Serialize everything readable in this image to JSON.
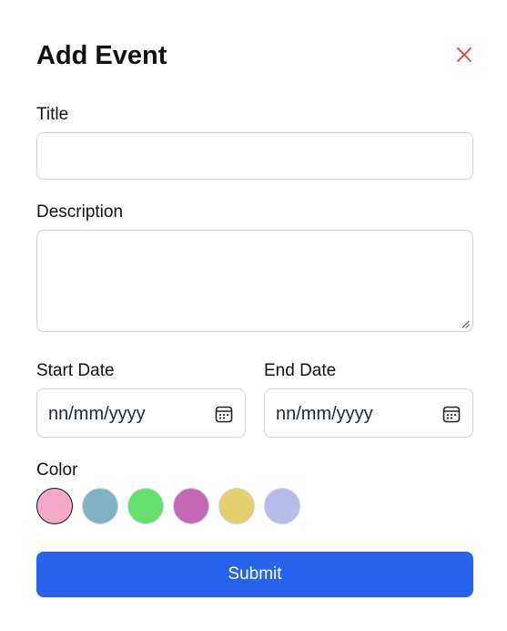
{
  "modal": {
    "title": "Add Event",
    "close_icon": "close-icon"
  },
  "form": {
    "title_label": "Title",
    "title_value": "",
    "description_label": "Description",
    "description_value": "",
    "start_date_label": "Start Date",
    "start_date_placeholder": "nn/mm/yyyy",
    "end_date_label": "End Date",
    "end_date_placeholder": "nn/mm/yyyy",
    "color_label": "Color",
    "colors": [
      "#f5a9c8",
      "#7fb3c4",
      "#66e06b",
      "#c566b7",
      "#e5cf6c",
      "#b8bbe8"
    ],
    "selected_color_index": 0,
    "submit_label": "Submit"
  },
  "theme": {
    "accent": "#2563eb",
    "close_color": "#e0413a"
  },
  "icons": {
    "calendar": "calendar-icon",
    "resize": "resize-handle-icon"
  }
}
